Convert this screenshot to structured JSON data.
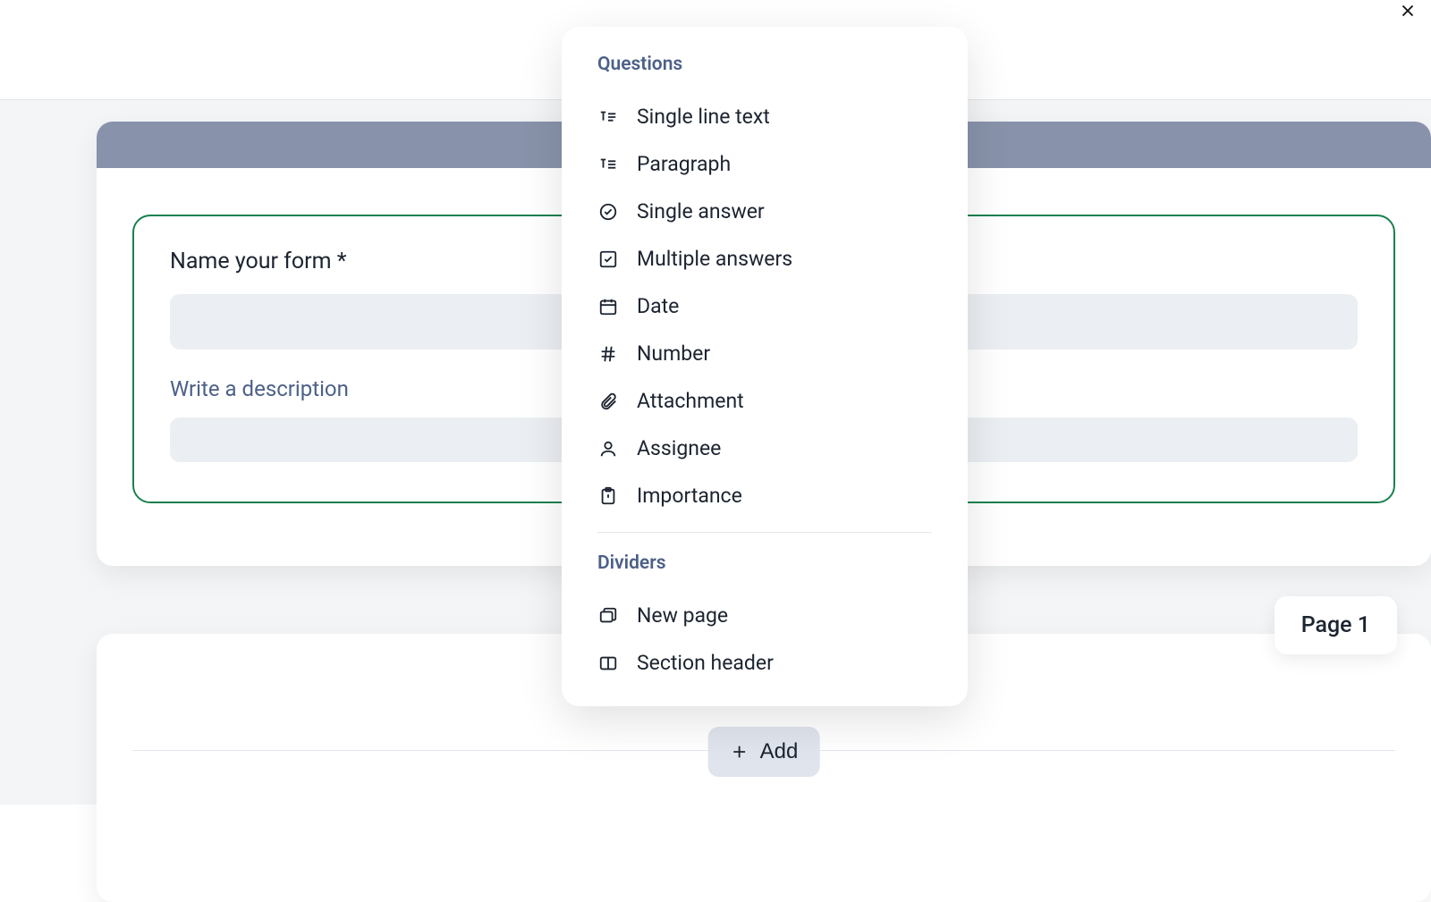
{
  "form": {
    "title_label": "Name your form *",
    "description_label": "Write a description"
  },
  "popup": {
    "section_questions": "Questions",
    "section_dividers": "Dividers",
    "items_questions": [
      "Single line text",
      "Paragraph",
      "Single answer",
      "Multiple answers",
      "Date",
      "Number",
      "Attachment",
      "Assignee",
      "Importance"
    ],
    "items_dividers": [
      "New page",
      "Section header"
    ]
  },
  "page": {
    "badge": "Page 1",
    "add_button": "Add"
  }
}
